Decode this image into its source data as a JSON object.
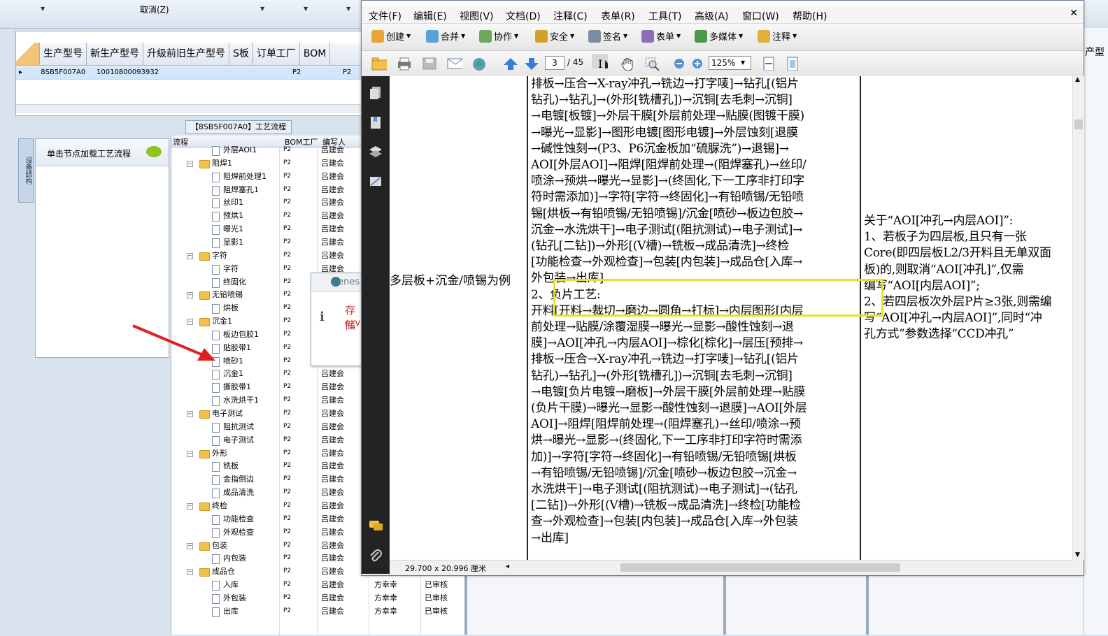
{
  "erp": {
    "cancel_label": "取消(Z)",
    "grid_headers": [
      "生产型号",
      "新生产型号",
      "升级前旧生产型号",
      "S板",
      "订单工厂",
      "BOM"
    ],
    "grid_row": [
      "8SB5F007A0",
      "10010800093932",
      "",
      "",
      "P2",
      "P2"
    ],
    "flow_title": "【8SB5F007A0】工艺流程",
    "side_tab": "设备结构",
    "load_hint": "单击节点加载工艺流程",
    "tree_headers": {
      "flow": "流程",
      "bom": "BOM工厂",
      "writer": "编写人"
    },
    "tree_rows": [
      {
        "label": "外层AOI1",
        "kind": "doc",
        "bom": "P2",
        "writer": "吕建会",
        "x1": "",
        "x2": ""
      },
      {
        "label": "阻焊1",
        "kind": "folder",
        "bom": "P2",
        "writer": "吕建会",
        "x1": "",
        "x2": ""
      },
      {
        "label": "阻焊前处理1",
        "kind": "doc",
        "bom": "P2",
        "writer": "吕建会",
        "x1": "",
        "x2": ""
      },
      {
        "label": "阻焊塞孔1",
        "kind": "doc",
        "bom": "P2",
        "writer": "吕建会",
        "x1": "",
        "x2": ""
      },
      {
        "label": "丝印1",
        "kind": "doc",
        "bom": "P2",
        "writer": "吕建会",
        "x1": "",
        "x2": ""
      },
      {
        "label": "预烘1",
        "kind": "doc",
        "bom": "P2",
        "writer": "吕建会",
        "x1": "",
        "x2": ""
      },
      {
        "label": "曝光1",
        "kind": "doc",
        "bom": "P2",
        "writer": "吕建会",
        "x1": "",
        "x2": ""
      },
      {
        "label": "显影1",
        "kind": "doc",
        "bom": "P2",
        "writer": "吕建会",
        "x1": "",
        "x2": ""
      },
      {
        "label": "字符",
        "kind": "folder",
        "bom": "P2",
        "writer": "吕建会",
        "x1": "",
        "x2": ""
      },
      {
        "label": "字符",
        "kind": "doc",
        "bom": "P2",
        "writer": "吕建会",
        "x1": "",
        "x2": ""
      },
      {
        "label": "终固化",
        "kind": "doc",
        "bom": "P2",
        "writer": "",
        "x1": "",
        "x2": ""
      },
      {
        "label": "无铅喷锡",
        "kind": "folder",
        "bom": "P2",
        "writer": "",
        "x1": "",
        "x2": ""
      },
      {
        "label": "烘板",
        "kind": "doc",
        "bom": "P2",
        "writer": "",
        "x1": "",
        "x2": ""
      },
      {
        "label": "沉金1",
        "kind": "folder",
        "bom": "P2",
        "writer": "",
        "x1": "",
        "x2": ""
      },
      {
        "label": "板边包胶1",
        "kind": "doc",
        "bom": "P2",
        "writer": "",
        "x1": "",
        "x2": ""
      },
      {
        "label": "贴胶带1",
        "kind": "doc",
        "bom": "P2",
        "writer": "",
        "x1": "",
        "x2": ""
      },
      {
        "label": "喷砂1",
        "kind": "doc",
        "bom": "P2",
        "writer": "",
        "x1": "",
        "x2": ""
      },
      {
        "label": "沉金1",
        "kind": "doc",
        "bom": "P2",
        "writer": "吕建会",
        "x1": "",
        "x2": ""
      },
      {
        "label": "撕胶带1",
        "kind": "doc",
        "bom": "P2",
        "writer": "吕建会",
        "x1": "",
        "x2": ""
      },
      {
        "label": "水洗烘干1",
        "kind": "doc",
        "bom": "P2",
        "writer": "吕建会",
        "x1": "",
        "x2": ""
      },
      {
        "label": "电子测试",
        "kind": "folder",
        "bom": "P2",
        "writer": "吕建会",
        "x1": "",
        "x2": ""
      },
      {
        "label": "阻抗测试",
        "kind": "doc",
        "bom": "P2",
        "writer": "吕建会",
        "x1": "",
        "x2": ""
      },
      {
        "label": "电子测试",
        "kind": "doc",
        "bom": "P2",
        "writer": "吕建会",
        "x1": "",
        "x2": ""
      },
      {
        "label": "外形",
        "kind": "folder",
        "bom": "P2",
        "writer": "吕建会",
        "x1": "",
        "x2": ""
      },
      {
        "label": "铣板",
        "kind": "doc",
        "bom": "P2",
        "writer": "吕建会",
        "x1": "",
        "x2": ""
      },
      {
        "label": "金指倒边",
        "kind": "doc",
        "bom": "P2",
        "writer": "吕建会",
        "x1": "",
        "x2": ""
      },
      {
        "label": "成品清洗",
        "kind": "doc",
        "bom": "P2",
        "writer": "吕建会",
        "x1": "",
        "x2": ""
      },
      {
        "label": "终检",
        "kind": "folder",
        "bom": "P2",
        "writer": "吕建会",
        "x1": "",
        "x2": ""
      },
      {
        "label": "功能检查",
        "kind": "doc",
        "bom": "P2",
        "writer": "吕建会",
        "x1": "",
        "x2": ""
      },
      {
        "label": "外观检查",
        "kind": "doc",
        "bom": "P2",
        "writer": "吕建会",
        "x1": "",
        "x2": ""
      },
      {
        "label": "包装",
        "kind": "folder",
        "bom": "P2",
        "writer": "吕建会",
        "x1": "",
        "x2": ""
      },
      {
        "label": "内包装",
        "kind": "doc",
        "bom": "P2",
        "writer": "吕建会",
        "x1": "",
        "x2": ""
      },
      {
        "label": "成品仓",
        "kind": "folder",
        "bom": "P2",
        "writer": "吕建会",
        "x1": "",
        "x2": ""
      },
      {
        "label": "入库",
        "kind": "doc",
        "bom": "P2",
        "writer": "吕建会",
        "x1": "方幸幸",
        "x2": "已审核"
      },
      {
        "label": "外包装",
        "kind": "doc",
        "bom": "P2",
        "writer": "吕建会",
        "x1": "方幸幸",
        "x2": "已审核"
      },
      {
        "label": "出库",
        "kind": "doc",
        "bom": "P2",
        "writer": "吕建会",
        "x1": "方幸幸",
        "x2": "已审核"
      }
    ],
    "dialog": {
      "title": "Genes",
      "msg1": "存储",
      "msg2": "e_v"
    },
    "right_strip_text": "产型"
  },
  "acrobat": {
    "menus": [
      "文件(F)",
      "编辑(E)",
      "视图(V)",
      "文档(D)",
      "注释(C)",
      "表单(R)",
      "工具(T)",
      "高级(A)",
      "窗口(W)",
      "帮助(H)"
    ],
    "tools": [
      {
        "label": "创建",
        "color": "#e8a53a"
      },
      {
        "label": "合并",
        "color": "#5aa1d8"
      },
      {
        "label": "协作",
        "color": "#6fa85c"
      },
      {
        "label": "安全",
        "color": "#d4a02a"
      },
      {
        "label": "签名",
        "color": "#7b8da3"
      },
      {
        "label": "表单",
        "color": "#8a6fb8"
      },
      {
        "label": "多媒体",
        "color": "#4a9a4a"
      },
      {
        "label": "注释",
        "color": "#e0b03c"
      }
    ],
    "page_current": "3",
    "page_total": "/ 45",
    "zoom": "125%",
    "page_size": "29.700 x 20.996 厘米",
    "left_cell": "多层板+沉金/喷锡为例",
    "mid_lines": [
      "排板→压合→X-ray冲孔→铣边→打字唛]→钻孔[(铝片",
      "钻孔)→钻孔]→(外形[铣槽孔])→沉铜[去毛刺→沉铜]",
      "→电镀[板镀]→外层干膜[外层前处理→贴膜(图镀干膜)",
      "→曝光→显影]→图形电镀[图形电镀]→外层蚀刻[退膜",
      "→碱性蚀刻→(P3、P6沉金板加“硫脲洗”)→退锡]→",
      "AOI[外层AOI]→阻焊[阻焊前处理→(阻焊塞孔)→丝印/",
      "喷涂→预烘→曝光→显影]→(终固化,下一工序非打印字",
      "符时需添加)]→字符[字符→终固化]→有铅喷锡/无铅喷",
      "锡[烘板→有铅喷锡/无铅喷锡]/沉金[喷砂→板边包胶→",
      "沉金→水洗烘干]→电子测试[(阻抗测试)→电子测试]→",
      "(钻孔[二钻])→外形[(V槽)→铣板→成品清洗]→终检",
      "[功能检查→外观检查]→包装[内包装]→成品仓[入库→",
      "外包装→出库]",
      "2、负片工艺:",
      "开料[开料→裁切→磨边→圆角→打标]→内层图形[内层",
      "前处理→贴膜/涂覆湿膜→曝光→显影→酸性蚀刻→退",
      "膜]→AOI[冲孔→内层AOI]→棕化[棕化]→层压[预排→",
      "排板→压合→X-ray冲孔→铣边→打字唛]→钻孔[(铝片",
      "钻孔)→钻孔]→(外形[铣槽孔])→沉铜[去毛刺→沉铜]",
      "→电镀[负片电镀→磨板]→外层干膜[外层前处理→贴膜",
      "(负片干膜)→曝光→显影→酸性蚀刻→退膜]→AOI[外层",
      "AOI]→阻焊[阻焊前处理→(阻焊塞孔)→丝印/喷涂→预",
      "烘→曝光→显影→(终固化,下一工序非打印字符时需添",
      "加)]→字符[字符→终固化]→有铅喷锡/无铅喷锡[烘板",
      "→有铅喷锡/无铅喷锡]/沉金[喷砂→板边包胶→沉金→",
      "水洗烘干]→电子测试[(阻抗测试)→电子测试]→(钻孔",
      "[二钻])→外形[(V槽)→铣板→成品清洗]→终检[功能检",
      "查→外观检查]→包装[内包装]→成品仓[入库→外包装",
      "→出库]"
    ],
    "right_lines": [
      "关于“AOI[冲孔→内层AOI]”:",
      "1、若板子为四层板,且只有一张",
      "Core(即四层板L2/3开料且无单双面",
      "板)的,则取消“AOI[冲孔]”,仅需",
      "编写“AOI[内层AOI]”;",
      "2、若四层板次外层P片≥3张,则需编",
      "写“AOI[冲孔→内层AOI]”,同时“冲",
      "孔方式”参数选择“CCD冲孔”"
    ]
  },
  "colors": {
    "highlight": "#e8e020",
    "arrow": "#e02020",
    "nav_dark": "#232323"
  }
}
